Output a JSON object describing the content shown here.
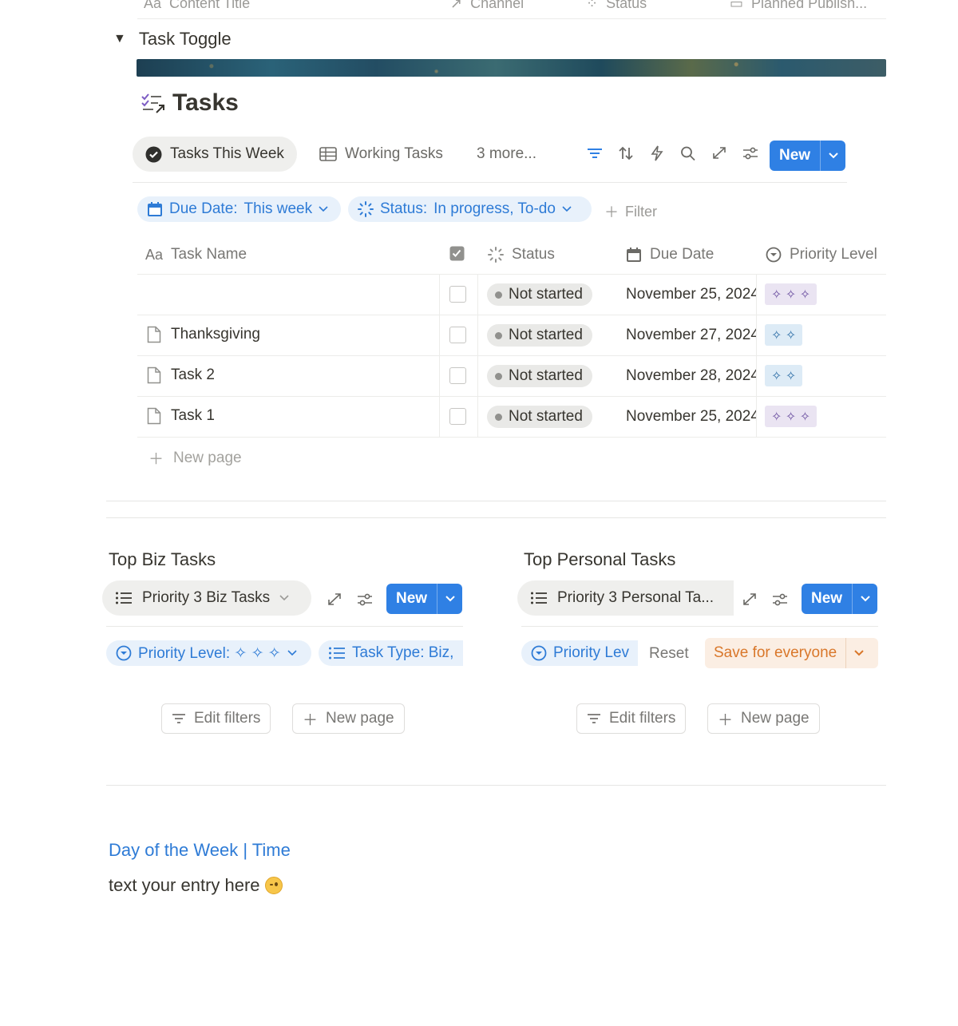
{
  "top_cut_header": {
    "columns": [
      "Content Title",
      "Channel",
      "Status",
      "Planned Publish..."
    ]
  },
  "toggle": {
    "label": "Task Toggle"
  },
  "database": {
    "title": "Tasks",
    "views": {
      "active": "Tasks This Week",
      "second": "Working Tasks",
      "more": "3 more..."
    },
    "new_label": "New",
    "filters": {
      "due_date_key": "Due Date:",
      "due_date_value": "This week",
      "status_key": "Status:",
      "status_value": "In progress, To-do",
      "add_filter": "Filter"
    },
    "columns": {
      "name": "Task Name",
      "status": "Status",
      "due_date": "Due Date",
      "priority": "Priority Level"
    },
    "rows": [
      {
        "name": "",
        "status": "Not started",
        "due_date": "November 25, 2024",
        "priority": "✧ ✧ ✧",
        "priority_level": 3
      },
      {
        "name": "Thanksgiving",
        "status": "Not started",
        "due_date": "November 27, 2024",
        "priority": "✧ ✧",
        "priority_level": 2
      },
      {
        "name": "Task 2",
        "status": "Not started",
        "due_date": "November 28, 2024",
        "priority": "✧ ✧",
        "priority_level": 2
      },
      {
        "name": "Task 1",
        "status": "Not started",
        "due_date": "November 25, 2024",
        "priority": "✧ ✧ ✧",
        "priority_level": 3
      }
    ],
    "new_page": "New page"
  },
  "biz": {
    "title": "Top Biz Tasks",
    "view": "Priority 3 Biz Tasks",
    "new_label": "New",
    "filter_priority": "Priority Level: ✧ ✧ ✧",
    "filter_type": "Task Type: Biz,",
    "edit_filters": "Edit filters",
    "new_page": "New page"
  },
  "personal": {
    "title": "Top Personal Tasks",
    "view": "Priority 3 Personal Ta...",
    "new_label": "New",
    "filter_priority": "Priority Lev",
    "reset": "Reset",
    "save_everyone": "Save for everyone",
    "edit_filters": "Edit filters",
    "new_page": "New page"
  },
  "journal": {
    "heading": "Day of the Week | Time",
    "entry": "text your entry here"
  },
  "colors": {
    "accent_blue": "#2f80e4",
    "chip_bg": "#e8f1fb",
    "orange": "#d9772a"
  }
}
